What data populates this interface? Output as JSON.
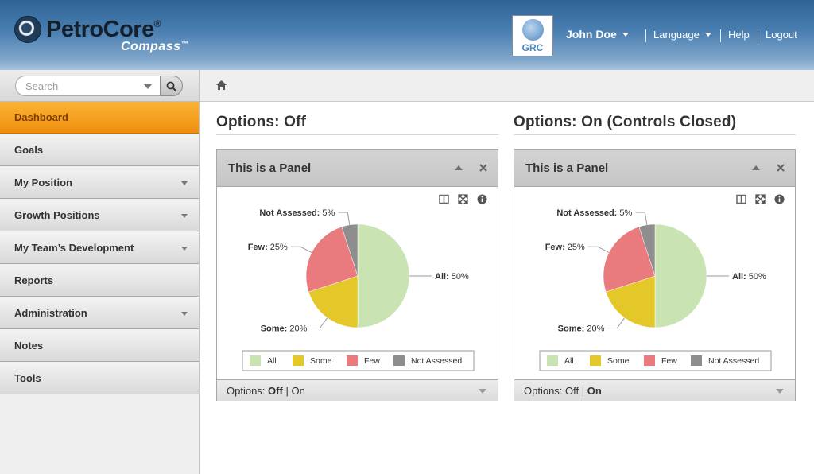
{
  "header": {
    "brand_name": "PetroCore",
    "brand_sub": "Compass",
    "reg_mark": "®",
    "tm_mark": "™",
    "badge_label": "GRC",
    "user_name": "John Doe",
    "language_label": "Language",
    "help_label": "Help",
    "logout_label": "Logout"
  },
  "search": {
    "placeholder": "Search"
  },
  "sidebar": {
    "items": [
      {
        "label": "Dashboard",
        "active": true,
        "has_dropdown": false
      },
      {
        "label": "Goals",
        "active": false,
        "has_dropdown": false
      },
      {
        "label": "My Position",
        "active": false,
        "has_dropdown": true
      },
      {
        "label": "Growth Positions",
        "active": false,
        "has_dropdown": true
      },
      {
        "label": "My Team’s Development",
        "active": false,
        "has_dropdown": true
      },
      {
        "label": "Reports",
        "active": false,
        "has_dropdown": false
      },
      {
        "label": "Administration",
        "active": false,
        "has_dropdown": true
      },
      {
        "label": "Notes",
        "active": false,
        "has_dropdown": false
      },
      {
        "label": "Tools",
        "active": false,
        "has_dropdown": false
      }
    ]
  },
  "sections": [
    {
      "title": "Options: Off",
      "panel_title": "This is a Panel",
      "footer_prefix": "Options:",
      "footer_off": "Off",
      "footer_sep": "|",
      "footer_on": "On",
      "selected": "off"
    },
    {
      "title": "Options: On (Controls Closed)",
      "panel_title": "This is a Panel",
      "footer_prefix": "Options:",
      "footer_off": "Off",
      "footer_sep": "|",
      "footer_on": "On",
      "selected": "on"
    }
  ],
  "chart_data": [
    {
      "type": "pie",
      "slices": [
        {
          "name": "All",
          "value": 50,
          "label": "50%",
          "color": "#c9e4b2"
        },
        {
          "name": "Some",
          "value": 20,
          "label": "20%",
          "color": "#e4c829"
        },
        {
          "name": "Few",
          "value": 25,
          "label": "25%",
          "color": "#e97b7e"
        },
        {
          "name": "Not Assessed",
          "value": 5,
          "label": "5%",
          "color": "#8e8e8e"
        }
      ],
      "legend": [
        "All",
        "Some",
        "Few",
        "Not Assessed"
      ],
      "legend_position": "bottom"
    },
    {
      "type": "pie",
      "slices": [
        {
          "name": "All",
          "value": 50,
          "label": "50%",
          "color": "#c9e4b2"
        },
        {
          "name": "Some",
          "value": 20,
          "label": "20%",
          "color": "#e4c829"
        },
        {
          "name": "Few",
          "value": 25,
          "label": "25%",
          "color": "#e97b7e"
        },
        {
          "name": "Not Assessed",
          "value": 5,
          "label": "5%",
          "color": "#8e8e8e"
        }
      ],
      "legend": [
        "All",
        "Some",
        "Few",
        "Not Assessed"
      ],
      "legend_position": "bottom"
    }
  ]
}
